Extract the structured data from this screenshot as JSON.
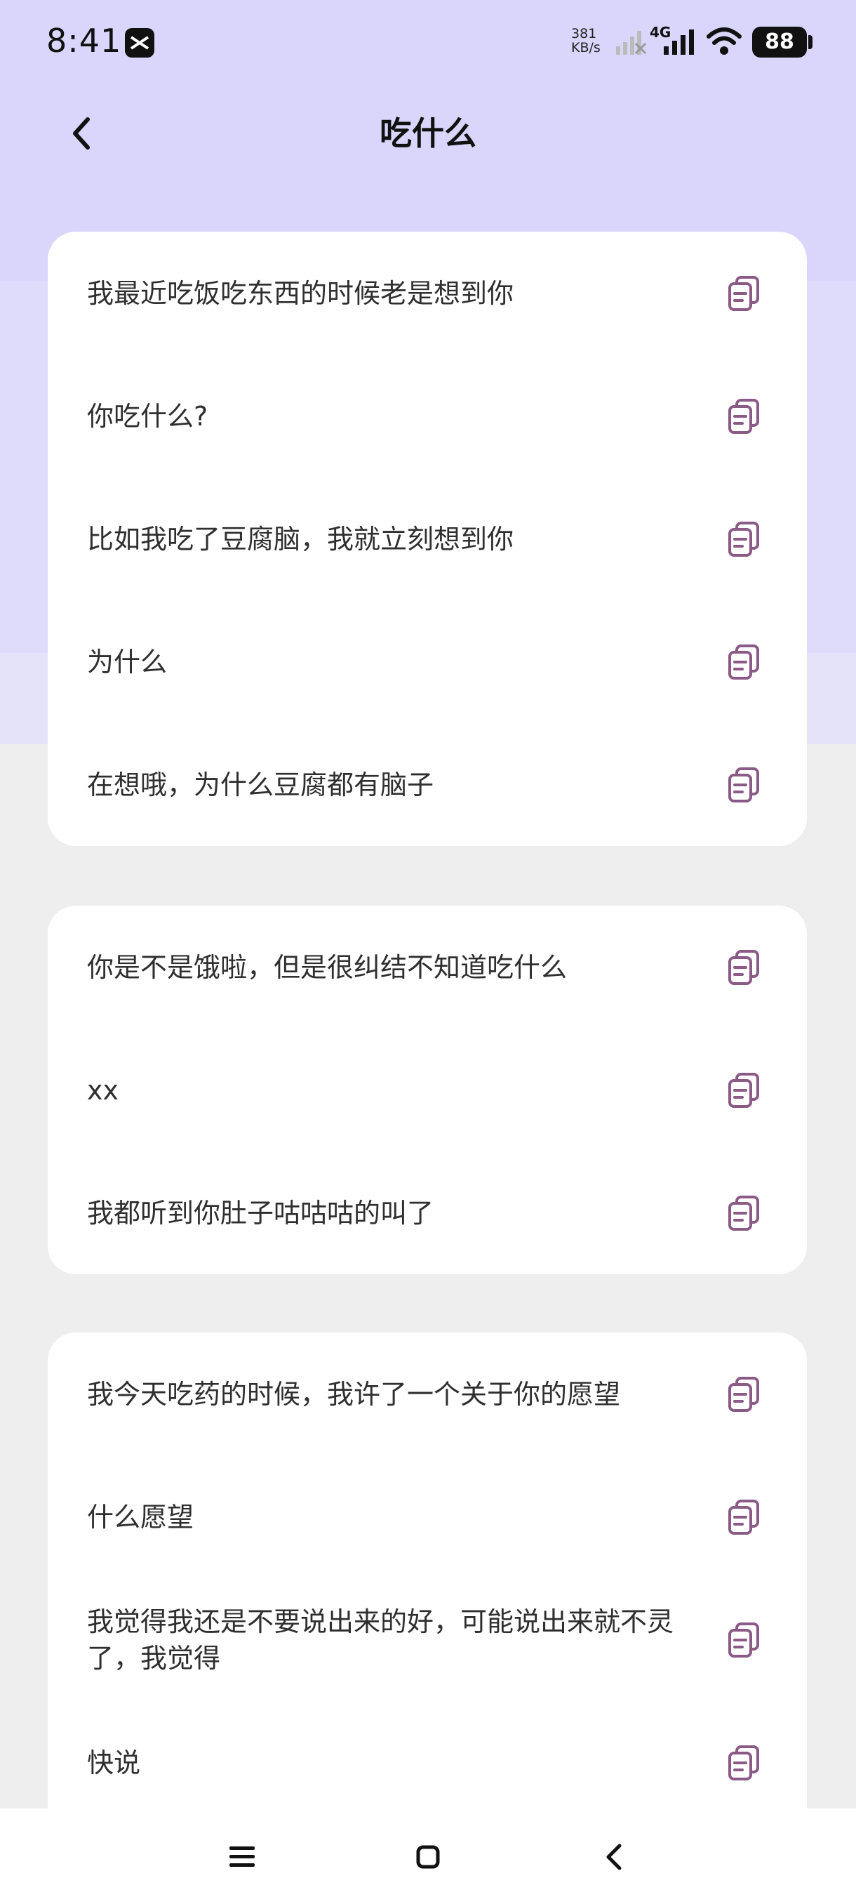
{
  "status_bar": {
    "time": "8:41",
    "net_speed_value": "381",
    "net_speed_unit": "KB/s",
    "network_type": "4G",
    "battery": "88"
  },
  "header": {
    "title": "吃什么"
  },
  "cards": [
    {
      "items": [
        "我最近吃饭吃东西的时候老是想到你",
        "你吃什么?",
        "比如我吃了豆腐脑，我就立刻想到你",
        "为什么",
        "在想哦，为什么豆腐都有脑子"
      ]
    },
    {
      "items": [
        "你是不是饿啦，但是很纠结不知道吃什么",
        "xx",
        "我都听到你肚子咕咕咕的叫了"
      ]
    },
    {
      "items": [
        "我今天吃药的时候，我许了一个关于你的愿望",
        "什么愿望",
        "我觉得我还是不要说出来的好，可能说出来就不灵了，我觉得",
        "快说"
      ]
    }
  ],
  "colors": {
    "accent_icon": "#8b5a86",
    "header_bg": "#d9d5fb",
    "page_bg": "#eeeeee",
    "card_bg": "#ffffff"
  },
  "icons": {
    "copy": "copy-icon",
    "back": "back-arrow-icon",
    "nav_menu": "menu-icon",
    "nav_home": "home-icon",
    "nav_back": "nav-back-icon"
  }
}
